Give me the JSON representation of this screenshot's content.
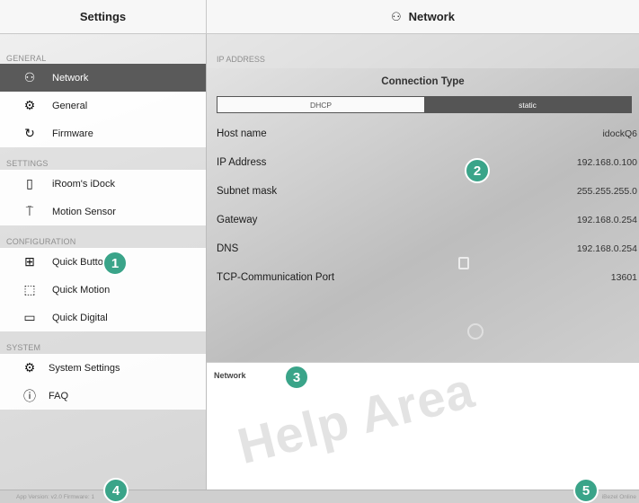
{
  "header": {
    "left_title": "Settings",
    "right_title": "Network",
    "right_icon": "network-icon"
  },
  "sidebar": {
    "sections": [
      {
        "title": "GENERAL"
      },
      {
        "title": "SETTINGS"
      },
      {
        "title": "CONFIGURATION"
      },
      {
        "title": "SYSTEM"
      }
    ],
    "items": [
      {
        "label": "Network",
        "icon": "network-icon",
        "active": true
      },
      {
        "label": "General",
        "icon": "gear-icon"
      },
      {
        "label": "Firmware",
        "icon": "refresh-icon"
      },
      {
        "label": "iRoom's iDock",
        "icon": "tablet-icon"
      },
      {
        "label": "Motion Sensor",
        "icon": "sensor-icon"
      },
      {
        "label": "Quick Buttons",
        "icon": "keypad-icon"
      },
      {
        "label": "Quick Motion",
        "icon": "remote-icon"
      },
      {
        "label": "Quick Digital",
        "icon": "laptop-icon"
      },
      {
        "label": "System Settings",
        "icon": "gear-icon"
      },
      {
        "label": "FAQ",
        "icon": "help-icon"
      }
    ]
  },
  "main": {
    "section_title": "IP ADDRESS",
    "connection_type_label": "Connection Type",
    "segments": [
      "DHCP",
      "static"
    ],
    "selected_segment": "static",
    "rows": [
      {
        "label": "Host name",
        "value": "idockQ6"
      },
      {
        "label": "IP Address",
        "value": "192.168.0.100"
      },
      {
        "label": "Subnet mask",
        "value": "255.255.255.0"
      },
      {
        "label": "Gateway",
        "value": "192.168.0.254"
      },
      {
        "label": "DNS",
        "value": "192.168.0.254"
      },
      {
        "label": "TCP-Communication Port",
        "value": "13601"
      }
    ]
  },
  "help": {
    "title": "Network",
    "watermark": "Help Area"
  },
  "footer": {
    "left_text": "App Version: v2.0 Firmware: 1",
    "right_text": "iBezel Online"
  },
  "callouts": [
    "1",
    "2",
    "3",
    "4",
    "5"
  ],
  "colors": {
    "accent": "#3aa489",
    "active_item": "#5a5a5a"
  }
}
